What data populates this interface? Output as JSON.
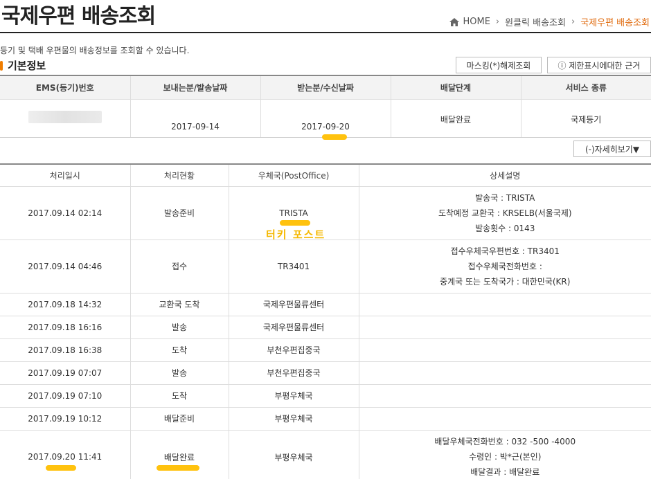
{
  "page": {
    "title": "국제우편 배송조회",
    "description": "등기 및 택배 우편물의 배송정보를 조회할 수 있습니다.",
    "section_title": "기본정보"
  },
  "breadcrumb": {
    "home": "HOME",
    "level1": "원클릭 배송조회",
    "current": "국제우편 배송조회"
  },
  "buttons": {
    "mask": "마스킹(*)해제조회",
    "limit": "ⓘ 제한표시에대한 근거",
    "detail": "(-)자세히보기▼"
  },
  "summary": {
    "headers": [
      "EMS(등기)번호",
      "보내는분/발송날짜",
      "받는분/수신날짜",
      "배달단계",
      "서비스 종류"
    ],
    "sent_date": "2017-09-14",
    "received_date": "2017-09-20",
    "stage": "배달완료",
    "service": "국제등기"
  },
  "history": {
    "headers": [
      "처리일시",
      "처리현황",
      "우체국(PostOffice)",
      "상세설명"
    ],
    "rows": [
      {
        "datetime": "2017.09.14 02:14",
        "status": "발송준비",
        "office": "TRISTA",
        "details": [
          "발송국 : TRISTA",
          "도착예정 교환국 : KRSELB(서울국제)",
          "발송횟수 : 0143"
        ]
      },
      {
        "datetime": "2017.09.14 04:46",
        "status": "접수",
        "office": "TR3401",
        "details": [
          "접수우체국우편번호 : TR3401",
          "접수우체국전화번호 :",
          "중계국 또는 도착국가 : 대한민국(KR)"
        ]
      },
      {
        "datetime": "2017.09.18 14:32",
        "status": "교환국 도착",
        "office": "국제우편물류센터",
        "details": []
      },
      {
        "datetime": "2017.09.18 16:16",
        "status": "발송",
        "office": "국제우편물류센터",
        "details": []
      },
      {
        "datetime": "2017.09.18 16:38",
        "status": "도착",
        "office": "부천우편집중국",
        "details": []
      },
      {
        "datetime": "2017.09.19 07:07",
        "status": "발송",
        "office": "부천우편집중국",
        "details": []
      },
      {
        "datetime": "2017.09.19 07:10",
        "status": "도착",
        "office": "부평우체국",
        "details": []
      },
      {
        "datetime": "2017.09.19 10:12",
        "status": "배달준비",
        "office": "부평우체국",
        "details": []
      },
      {
        "datetime": "2017.09.20 11:41",
        "status": "배달완료",
        "office": "부평우체국",
        "details": [
          "배달우체국전화번호 : 032 -500 -4000",
          "수령인 : 박*근(본인)",
          "배달결과 : 배달완료"
        ]
      }
    ]
  },
  "annotation": "터키 포스트",
  "colors": {
    "accent": "#e06a0c",
    "highlight": "#ffc20e",
    "annotation": "#f5b800"
  }
}
